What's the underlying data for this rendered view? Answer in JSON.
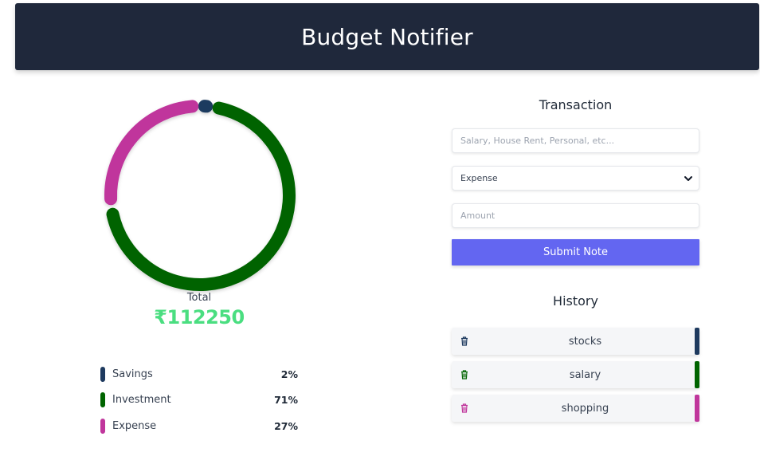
{
  "header": {
    "title": "Budget Notifier"
  },
  "summary": {
    "total_label": "Total",
    "total_value": "₹112250"
  },
  "chart_data": {
    "type": "pie",
    "categories": [
      "Savings",
      "Investment",
      "Expense"
    ],
    "values": [
      2,
      71,
      27
    ],
    "colors": [
      "#1e3a5f",
      "#006400",
      "#c0369c"
    ]
  },
  "legend": [
    {
      "name": "Savings",
      "pct": "2%",
      "color": "#1e3a5f"
    },
    {
      "name": "Investment",
      "pct": "71%",
      "color": "#006400"
    },
    {
      "name": "Expense",
      "pct": "27%",
      "color": "#c0369c"
    }
  ],
  "transaction": {
    "title": "Transaction",
    "note_placeholder": "Salary, House Rent, Personal, etc...",
    "type_selected": "Expense",
    "amount_placeholder": "Amount",
    "submit_label": "Submit Note"
  },
  "history": {
    "title": "History",
    "items": [
      {
        "label": "stocks",
        "color": "#1e3a5f"
      },
      {
        "label": "salary",
        "color": "#006400"
      },
      {
        "label": "shopping",
        "color": "#c0369c"
      }
    ]
  }
}
